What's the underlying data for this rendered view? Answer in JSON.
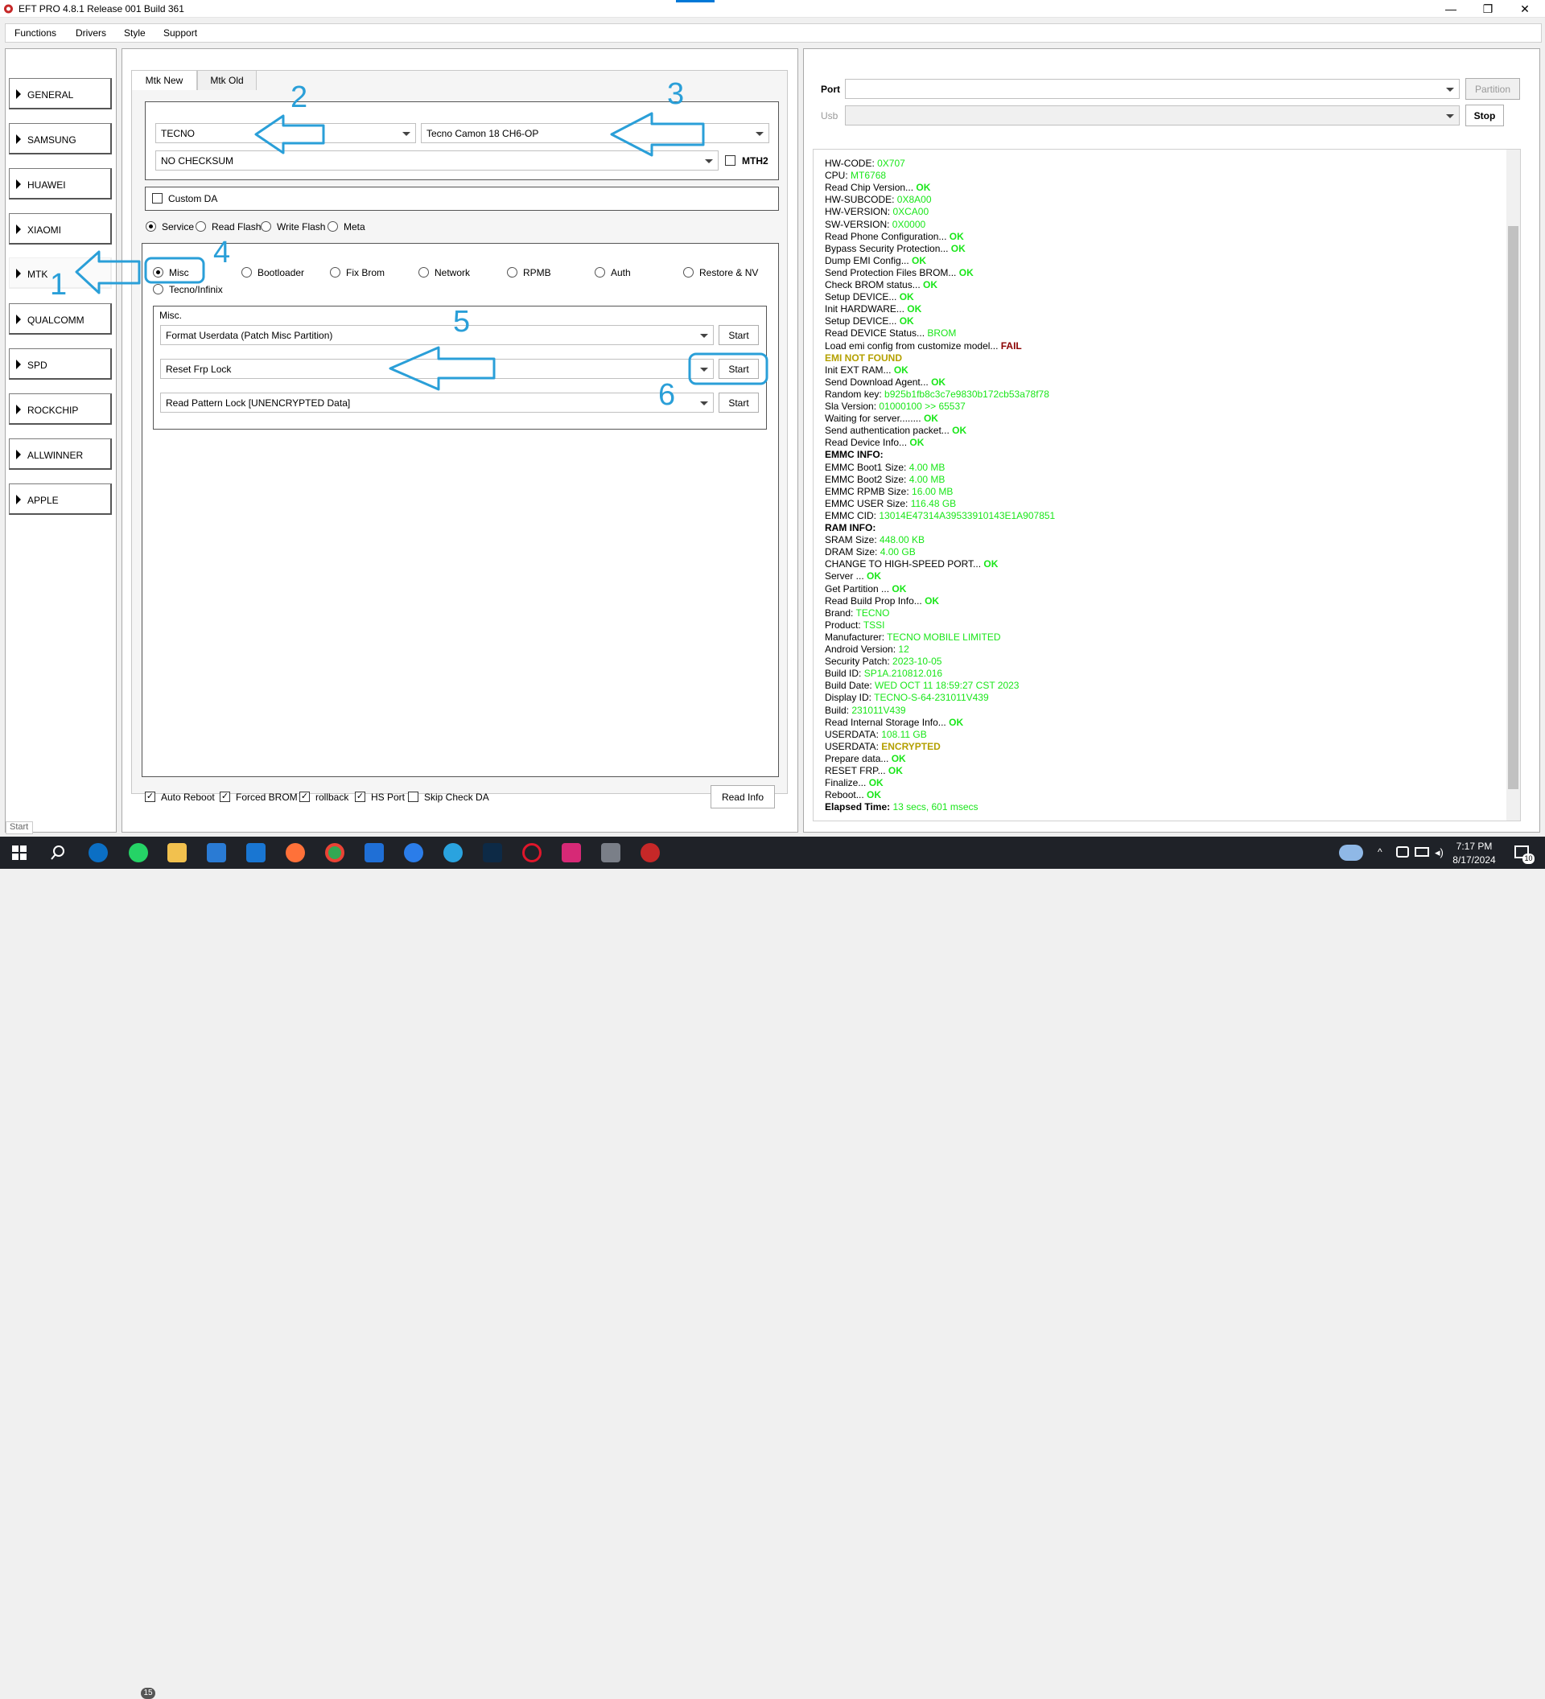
{
  "window": {
    "title": "EFT PRO 4.8.1 Release 001 Build 361",
    "minimize": "—",
    "restore": "❐",
    "close": "✕"
  },
  "menu": [
    "Functions",
    "Drivers",
    "Style",
    "Support"
  ],
  "sidebar": [
    {
      "label": "GENERAL"
    },
    {
      "label": "SAMSUNG"
    },
    {
      "label": "HUAWEI"
    },
    {
      "label": "XIAOMI"
    },
    {
      "label": "MTK"
    },
    {
      "label": "QUALCOMM"
    },
    {
      "label": "SPD"
    },
    {
      "label": "ROCKCHIP"
    },
    {
      "label": "ALLWINNER"
    },
    {
      "label": "APPLE"
    }
  ],
  "status": {
    "left": "Start"
  },
  "tabs": [
    {
      "label": "Mtk New"
    },
    {
      "label": "Mtk Old"
    }
  ],
  "brand": {
    "value": "TECNO"
  },
  "model": {
    "value": "Tecno Camon 18   CH6-OP"
  },
  "checksum": {
    "value": "NO CHECKSUM"
  },
  "mth2": {
    "label": "MTH2",
    "checked": false
  },
  "custom_da": {
    "label": "Custom DA",
    "checked": false
  },
  "modes": [
    {
      "label": "Service",
      "selected": true
    },
    {
      "label": "Read Flash",
      "selected": false
    },
    {
      "label": "Write Flash",
      "selected": false
    },
    {
      "label": "Meta",
      "selected": false
    }
  ],
  "functions": [
    {
      "label": "Misc",
      "selected": true
    },
    {
      "label": "Bootloader",
      "selected": false
    },
    {
      "label": "Fix Brom",
      "selected": false
    },
    {
      "label": "Network",
      "selected": false
    },
    {
      "label": "RPMB",
      "selected": false
    },
    {
      "label": "Auth",
      "selected": false
    },
    {
      "label": "Restore & NV",
      "selected": false
    },
    {
      "label": "Tecno/Infinix",
      "selected": false
    }
  ],
  "misc": {
    "group_label": "Misc.",
    "rows": [
      {
        "value": "Format Userdata (Patch Misc Partition)",
        "button": "Start"
      },
      {
        "value": "Reset Frp Lock",
        "button": "Start"
      },
      {
        "value": "Read Pattern Lock [UNENCRYPTED Data]",
        "button": "Start"
      }
    ]
  },
  "options": [
    {
      "label": "Auto Reboot",
      "checked": true
    },
    {
      "label": "Forced BROM",
      "checked": true
    },
    {
      "label": "rollback",
      "checked": true
    },
    {
      "label": "HS Port",
      "checked": true
    },
    {
      "label": "Skip Check DA",
      "checked": false
    }
  ],
  "read_info": "Read Info",
  "annotations": [
    "1",
    "2",
    "3",
    "4",
    "5",
    "6"
  ],
  "annotation_color": "#2a9fd8",
  "port": {
    "label": "Port",
    "value": "",
    "button": "Partition"
  },
  "usb": {
    "label": "Usb",
    "value": "",
    "button": "Stop"
  },
  "log": [
    [
      [
        "HW-CODE: ",
        "t"
      ],
      [
        "0X707",
        "val"
      ]
    ],
    [
      [
        "CPU: ",
        "t"
      ],
      [
        "MT6768",
        "val"
      ]
    ],
    [
      [
        "Read Chip Version... ",
        "t"
      ],
      [
        "OK",
        "ok"
      ]
    ],
    [
      [
        "HW-SUBCODE: ",
        "t"
      ],
      [
        "0X8A00",
        "val"
      ]
    ],
    [
      [
        "HW-VERSION: ",
        "t"
      ],
      [
        "0XCA00",
        "val"
      ]
    ],
    [
      [
        "SW-VERSION: ",
        "t"
      ],
      [
        "0X0000",
        "val"
      ]
    ],
    [
      [
        "Read Phone Configuration... ",
        "t"
      ],
      [
        "OK",
        "ok"
      ]
    ],
    [
      [
        "Bypass Security Protection... ",
        "t"
      ],
      [
        "OK",
        "ok"
      ]
    ],
    [
      [
        "Dump EMI Config... ",
        "t"
      ],
      [
        "OK",
        "ok"
      ]
    ],
    [
      [
        "Send Protection Files BROM... ",
        "t"
      ],
      [
        "OK",
        "ok"
      ]
    ],
    [
      [
        "Check BROM status... ",
        "t"
      ],
      [
        "OK",
        "ok"
      ]
    ],
    [
      [
        "Setup DEVICE... ",
        "t"
      ],
      [
        "OK",
        "ok"
      ]
    ],
    [
      [
        "Init HARDWARE... ",
        "t"
      ],
      [
        "OK",
        "ok"
      ]
    ],
    [
      [
        "Setup DEVICE... ",
        "t"
      ],
      [
        "OK",
        "ok"
      ]
    ],
    [
      [
        "Read DEVICE Status... ",
        "t"
      ],
      [
        "BROM",
        "val"
      ]
    ],
    [
      [
        "Load emi config from customize model... ",
        "t"
      ],
      [
        "FAIL",
        "fail"
      ]
    ],
    [
      [
        "  EMI NOT FOUND",
        "warn"
      ]
    ],
    [
      [
        "Init EXT RAM... ",
        "t"
      ],
      [
        "OK",
        "ok"
      ]
    ],
    [
      [
        "Send Download Agent... ",
        "t"
      ],
      [
        "OK",
        "ok"
      ]
    ],
    [
      [
        "Random key:  ",
        "t"
      ],
      [
        "b925b1fb8c3c7e9830b172cb53a78f78",
        "val"
      ]
    ],
    [
      [
        "Sla Version:  ",
        "t"
      ],
      [
        "01000100  >> 65537",
        "val"
      ]
    ],
    [
      [
        "Waiting for server........ ",
        "t"
      ],
      [
        "OK",
        "ok"
      ]
    ],
    [
      [
        "Send authentication packet... ",
        "t"
      ],
      [
        "OK",
        "ok"
      ]
    ],
    [
      [
        "Read Device Info... ",
        "t"
      ],
      [
        "OK",
        "ok"
      ]
    ],
    [
      [
        "EMMC INFO:",
        "bold"
      ]
    ],
    [
      [
        "EMMC Boot1 Size: ",
        "t"
      ],
      [
        "4.00 MB",
        "val"
      ]
    ],
    [
      [
        "EMMC Boot2 Size: ",
        "t"
      ],
      [
        "4.00 MB",
        "val"
      ]
    ],
    [
      [
        "EMMC RPMB Size: ",
        "t"
      ],
      [
        "16.00 MB",
        "val"
      ]
    ],
    [
      [
        "EMMC USER Size: ",
        "t"
      ],
      [
        "116.48 GB",
        "val"
      ]
    ],
    [
      [
        "EMMC CID: ",
        "t"
      ],
      [
        "13014E47314A39533910143E1A907851",
        "val"
      ]
    ],
    [
      [
        "RAM INFO:",
        "bold"
      ]
    ],
    [
      [
        "SRAM Size: ",
        "t"
      ],
      [
        "448.00 KB",
        "val"
      ]
    ],
    [
      [
        "DRAM Size: ",
        "t"
      ],
      [
        "4.00 GB",
        "val"
      ]
    ],
    [
      [
        "CHANGE TO HIGH-SPEED PORT... ",
        "t"
      ],
      [
        "OK",
        "ok"
      ]
    ],
    [
      [
        "Server ... ",
        "t"
      ],
      [
        "OK",
        "ok"
      ]
    ],
    [
      [
        "Get Partition ... ",
        "t"
      ],
      [
        "OK",
        "ok"
      ]
    ],
    [
      [
        "Read Build Prop Info... ",
        "t"
      ],
      [
        "OK",
        "ok"
      ]
    ],
    [
      [
        " Brand: ",
        "t"
      ],
      [
        "TECNO",
        "val"
      ]
    ],
    [
      [
        " Product: ",
        "t"
      ],
      [
        "TSSI",
        "val"
      ]
    ],
    [
      [
        " Manufacturer: ",
        "t"
      ],
      [
        "TECNO MOBILE LIMITED",
        "val"
      ]
    ],
    [
      [
        " Android Version: ",
        "t"
      ],
      [
        "12",
        "val"
      ]
    ],
    [
      [
        " Security Patch: ",
        "t"
      ],
      [
        "2023-10-05",
        "val"
      ]
    ],
    [
      [
        " Build ID: ",
        "t"
      ],
      [
        "SP1A.210812.016",
        "val"
      ]
    ],
    [
      [
        " Build Date: ",
        "t"
      ],
      [
        "WED OCT 11 18:59:27 CST 2023",
        "val"
      ]
    ],
    [
      [
        " Display ID: ",
        "t"
      ],
      [
        "TECNO-S-64-231011V439",
        "val"
      ]
    ],
    [
      [
        " Build: ",
        "t"
      ],
      [
        "231011V439",
        "val"
      ]
    ],
    [
      [
        "Read Internal Storage Info... ",
        "t"
      ],
      [
        "OK",
        "ok"
      ]
    ],
    [
      [
        "USERDATA: ",
        "t"
      ],
      [
        "108.11 GB",
        "val"
      ]
    ],
    [
      [
        "USERDATA: ",
        "t"
      ],
      [
        "ENCRYPTED",
        "warn"
      ]
    ],
    [
      [
        "Prepare data... ",
        "t"
      ],
      [
        "OK",
        "ok"
      ]
    ],
    [
      [
        "RESET FRP... ",
        "t"
      ],
      [
        "OK",
        "ok"
      ]
    ],
    [
      [
        "Finalize... ",
        "t"
      ],
      [
        "OK",
        "ok"
      ]
    ],
    [
      [
        "Reboot... ",
        "t"
      ],
      [
        "OK",
        "ok"
      ]
    ],
    [
      [
        "Elapsed Time: ",
        "bold"
      ],
      [
        "13 secs, 601 msecs",
        "val"
      ]
    ]
  ],
  "taskbar": {
    "whatsapp_badge": "15",
    "notif_badge": "10",
    "time": "7:17 PM",
    "date": "8/17/2024",
    "icons": [
      "windows-icon",
      "search-icon",
      "edge-icon",
      "whatsapp-icon",
      "file-explorer-icon",
      "store-icon",
      "mail-icon",
      "firefox-icon",
      "chrome-icon",
      "app-3-icon",
      "settings-icon",
      "telegram-icon",
      "photoshop-icon",
      "opera-icon",
      "instagram-icon",
      "app-tool-icon",
      "eft-icon"
    ]
  }
}
